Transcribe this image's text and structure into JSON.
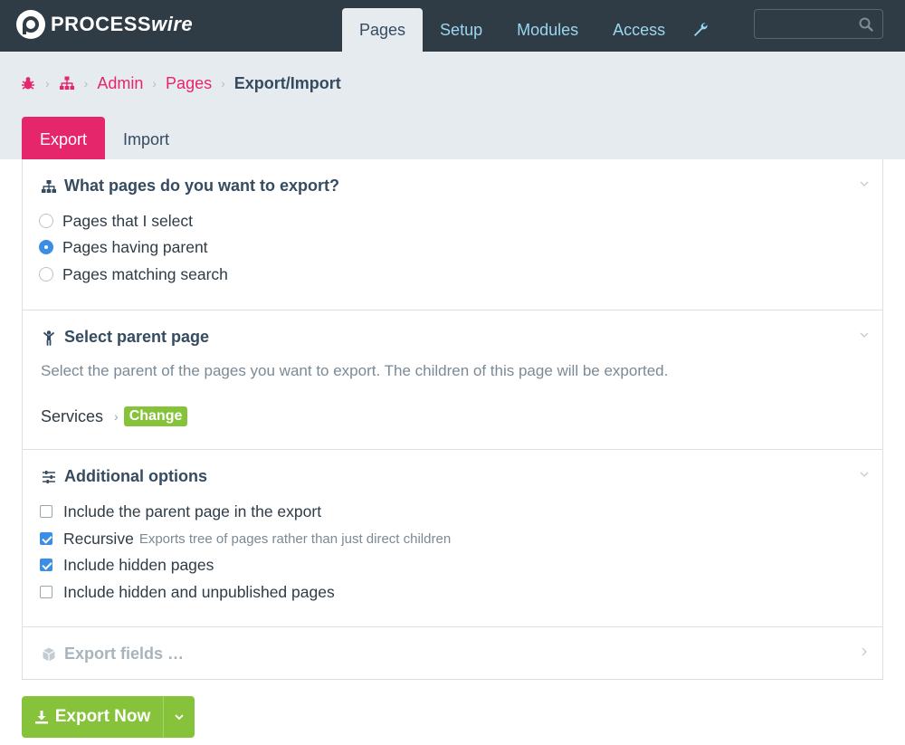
{
  "app": {
    "logo_text_bold": "PROCESS",
    "logo_text_italic": "wire"
  },
  "nav": {
    "items": [
      {
        "label": "Pages",
        "active": true
      },
      {
        "label": "Setup",
        "active": false
      },
      {
        "label": "Modules",
        "active": false
      },
      {
        "label": "Access",
        "active": false
      }
    ],
    "tools_icon": "wrench-icon",
    "search": {
      "placeholder": "",
      "value": "",
      "icon": "search-icon"
    }
  },
  "breadcrumbs": {
    "home_icon": "bug-icon",
    "tree_icon": "sitemap-icon",
    "items": [
      "Admin",
      "Pages"
    ],
    "current": "Export/Import"
  },
  "tabs": [
    {
      "label": "Export",
      "active": true
    },
    {
      "label": "Import",
      "active": false
    }
  ],
  "sections": {
    "which_pages": {
      "title": "What pages do you want to export?",
      "icon": "sitemap-icon",
      "options": [
        {
          "label": "Pages that I select",
          "selected": false
        },
        {
          "label": "Pages having parent",
          "selected": true
        },
        {
          "label": "Pages matching search",
          "selected": false
        }
      ]
    },
    "parent_page": {
      "title": "Select parent page",
      "icon": "child-icon",
      "description": "Select the parent of the pages you want to export. The children of this page will be exported.",
      "selected_page": "Services",
      "change_label": "Change"
    },
    "additional": {
      "title": "Additional options",
      "icon": "sliders-icon",
      "options": [
        {
          "label": "Include the parent page in the export",
          "checked": false,
          "note": ""
        },
        {
          "label": "Recursive",
          "checked": true,
          "note": "Exports tree of pages rather than just direct children"
        },
        {
          "label": "Include hidden pages",
          "checked": true,
          "note": ""
        },
        {
          "label": "Include hidden and unpublished pages",
          "checked": false,
          "note": ""
        }
      ]
    },
    "export_fields": {
      "title": "Export fields …",
      "icon": "cube-icon"
    }
  },
  "export_button": {
    "label": "Export Now",
    "icon": "download-icon",
    "dropdown_icon": "chevron-down-icon"
  },
  "colors": {
    "topbar": "#2f3b45",
    "accent_pink": "#e5266b",
    "nav_link": "#9ad7f0",
    "green": "#86c23a",
    "radio_blue": "#3a8ee6",
    "header_bg": "#e6ebef"
  }
}
